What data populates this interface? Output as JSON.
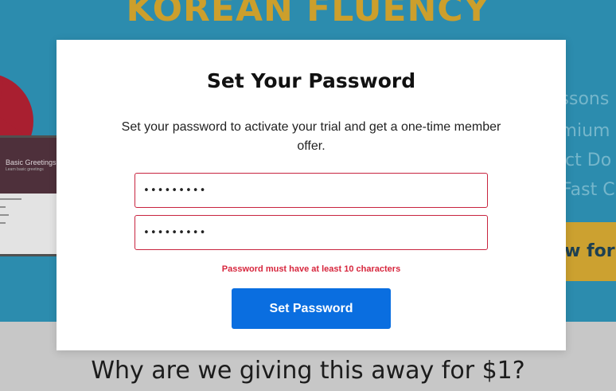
{
  "background": {
    "hero_title": "KOREAN FLUENCY",
    "laptop": {
      "lesson_title": "Basic Greetings",
      "lesson_subtitle": "Learn basic greetings"
    },
    "features": [
      {
        "text": "essons"
      },
      {
        "text": "emium"
      },
      {
        "text": "luct Do"
      },
      {
        "text": "r Fast C"
      }
    ],
    "cta_label": "ow for",
    "lower_heading": "Why are we giving this away for $1?"
  },
  "modal": {
    "title": "Set Your Password",
    "description": "Set your password to activate your trial and get a one-time member offer.",
    "password_value": "•••••••••",
    "confirm_password_value": "•••••••••",
    "error": "Password must have at least 10 characters",
    "submit_label": "Set Password"
  },
  "colors": {
    "hero_bg": "#2f95b9",
    "title_gold": "#d9a92f",
    "error_red": "#d7263d",
    "primary_blue": "#0a6ee0"
  }
}
